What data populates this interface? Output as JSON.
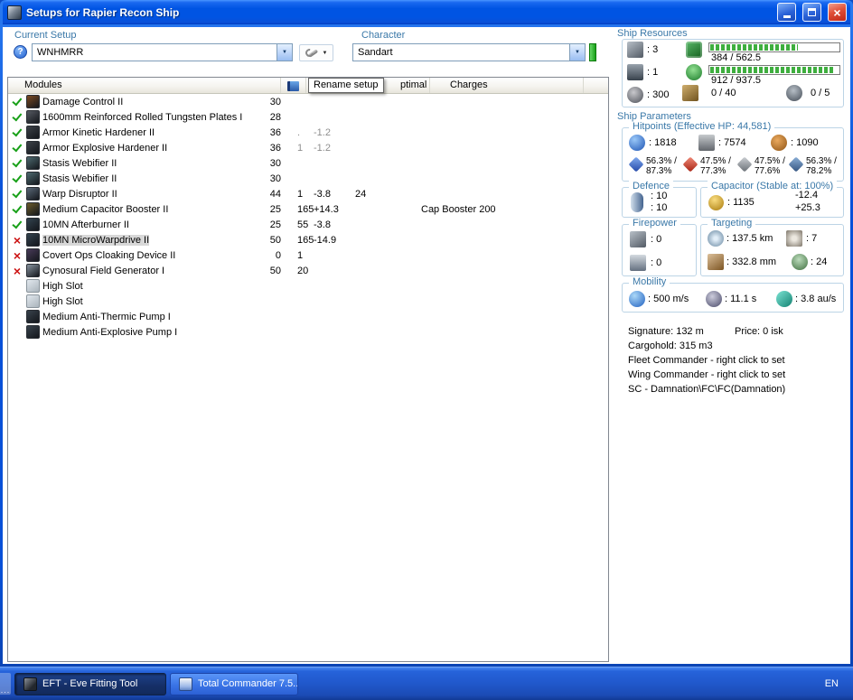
{
  "window": {
    "title": "Setups for Rapier Recon Ship"
  },
  "toolbar": {
    "current_setup_label": "Current Setup",
    "current_setup_value": "WNHMRR",
    "character_label": "Character",
    "character_value": "Sandart"
  },
  "tooltip": "Rename setup",
  "modules_table": {
    "headers": {
      "modules": "Modules",
      "optimal": "ptimal",
      "charges": "Charges"
    },
    "rows": [
      {
        "status": "ok",
        "name": "Damage Control II",
        "cpu": "30",
        "icon_color": "#7a4a22"
      },
      {
        "status": "ok",
        "name": "1600mm Reinforced Rolled Tungsten Plates I",
        "cpu": "28",
        "icon_color": "#565a62"
      },
      {
        "status": "ok",
        "name": "Armor Kinetic Hardener II",
        "cpu": "36",
        "grid": ".",
        "cap": "-1.2",
        "faint": true,
        "icon_color": "#3c4148"
      },
      {
        "status": "ok",
        "name": "Armor Explosive Hardener II",
        "cpu": "36",
        "grid": "1",
        "cap": "-1.2",
        "faint": true,
        "icon_color": "#3c4148"
      },
      {
        "status": "ok",
        "name": "Stasis Webifier II",
        "cpu": "30",
        "icon_color": "#4e6a70"
      },
      {
        "status": "ok",
        "name": "Stasis Webifier II",
        "cpu": "30",
        "icon_color": "#4e6a70"
      },
      {
        "status": "ok",
        "name": "Warp Disruptor II",
        "cpu": "44",
        "grid": "1",
        "cap": "-3.8",
        "optimal": "24",
        "icon_color": "#5a6878"
      },
      {
        "status": "ok",
        "name": "Medium Capacitor Booster II",
        "cpu": "25",
        "grid": "165",
        "cap": "+14.3",
        "charges": "Cap Booster 200",
        "icon_color": "#6a5a2a"
      },
      {
        "status": "ok",
        "name": "10MN Afterburner II",
        "cpu": "25",
        "grid": "55",
        "cap": "-3.8",
        "icon_color": "#32424e"
      },
      {
        "status": "fail",
        "name": "10MN MicroWarpdrive II",
        "cpu": "50",
        "grid": "165",
        "cap": "-14.9",
        "selected": true,
        "icon_color": "#32424e"
      },
      {
        "status": "fail",
        "name": "Covert Ops Cloaking Device II",
        "cpu": "0",
        "grid": "1",
        "icon_color": "#483a58"
      },
      {
        "status": "fail",
        "name": "Cynosural Field Generator I",
        "cpu": "50",
        "grid": "20",
        "icon_color": "#8894a0"
      },
      {
        "status": "none",
        "name": "High Slot",
        "slot": true
      },
      {
        "status": "none",
        "name": "High Slot",
        "slot": true
      },
      {
        "status": "none",
        "name": "Medium Anti-Thermic Pump I",
        "icon_color": "#38424c"
      },
      {
        "status": "none",
        "name": "Medium Anti-Explosive Pump I",
        "icon_color": "#38424c"
      }
    ]
  },
  "ship_resources": {
    "label": "Ship Resources",
    "turret_hardpoints": ": 3",
    "launcher_hardpoints": ": 1",
    "calibration": ": 300",
    "cpu": {
      "text": "384 / 562.5",
      "pct": 68
    },
    "powergrid": {
      "text": "912 / 937.5",
      "pct": 97
    },
    "drone_bay": "0 / 40",
    "drones": "0 / 5"
  },
  "ship_parameters": {
    "label": "Ship Parameters",
    "hitpoints": {
      "label": "Hitpoints (Effective HP: 44,581)",
      "shield": ": 1818",
      "armor": ": 7574",
      "hull": ": 1090",
      "resists": [
        {
          "top": "56.3% /",
          "bottom": "87.3%"
        },
        {
          "top": "47.5% /",
          "bottom": "77.3%"
        },
        {
          "top": "47.5% /",
          "bottom": "77.6%"
        },
        {
          "top": "56.3% /",
          "bottom": "78.2%"
        }
      ]
    },
    "defence": {
      "label": "Defence",
      "value1": ": 10",
      "value2": ": 10"
    },
    "capacitor": {
      "label": "Capacitor (Stable at: 100%)",
      "amount": ": 1135",
      "usage": "-12.4",
      "recharge": "+25.3"
    },
    "firepower": {
      "label": "Firepower",
      "turrets": ": 0",
      "launchers": ": 0"
    },
    "targeting": {
      "label": "Targeting",
      "range": ": 137.5 km",
      "max_targets": ": 7",
      "scan_resolution": ": 332.8 mm",
      "sensor_strength": ": 24"
    },
    "mobility": {
      "label": "Mobility",
      "max_velocity": ": 500 m/s",
      "align_time": ": 11.1 s",
      "warp_speed": ": 3.8 au/s"
    }
  },
  "ship_info": {
    "signature": "Signature: 132 m",
    "price": "Price: 0 isk",
    "cargohold": "Cargohold: 315 m3",
    "fleet_commander": "Fleet Commander - right click to set",
    "wing_commander": "Wing Commander - right click to set",
    "sc": "SC - Damnation\\FC\\FC(Damnation)"
  },
  "taskbar": {
    "overflow": "...",
    "tasks": [
      {
        "label": "EFT - Eve Fitting Tool"
      },
      {
        "label": "Total Commander 7.5..."
      }
    ],
    "language": "EN"
  },
  "colors": {
    "titlebar_blue": "#0054e3",
    "group_label_teal": "#3a78a8",
    "check_green": "#18a018",
    "cross_red": "#cc1111",
    "bar_green": "#3fae3f",
    "selection_gray": "#d8d8d8"
  }
}
